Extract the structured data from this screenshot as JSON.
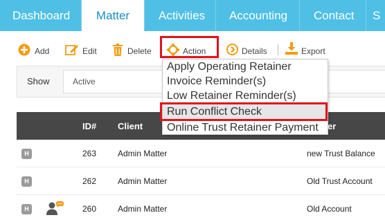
{
  "nav": {
    "tabs": [
      {
        "label": "Dashboard",
        "active": false
      },
      {
        "label": "Matter",
        "active": true
      },
      {
        "label": "Activities",
        "active": false
      },
      {
        "label": "Accounting",
        "active": false
      },
      {
        "label": "Contact",
        "active": false
      },
      {
        "label": "S",
        "active": false
      }
    ]
  },
  "toolbar": {
    "add_label": "Add",
    "edit_label": "Edit",
    "delete_label": "Delete",
    "action_label": "Action",
    "details_label": "Details",
    "export_label": "Export"
  },
  "filter": {
    "show_label": "Show",
    "status_value": "Active"
  },
  "table": {
    "headers": {
      "id": "ID#",
      "client": "Client",
      "matter_partial": "er"
    },
    "rows": [
      {
        "badge": "H",
        "id": "263",
        "client": "Admin Matter",
        "matter": "new Trust Balance",
        "has_contact_icon": false
      },
      {
        "badge": "H",
        "id": "262",
        "client": "Admin Matter",
        "matter": "Old Trust Account",
        "has_contact_icon": false
      },
      {
        "badge": "H",
        "id": "260",
        "client": "Admin Matter",
        "matter": "Old Account",
        "has_contact_icon": true
      }
    ]
  },
  "action_menu": {
    "items": [
      {
        "label": "Apply Operating Retainer"
      },
      {
        "label": "Invoice Reminder(s)"
      },
      {
        "label": "Low Retainer Reminder(s)"
      },
      {
        "label": "Run Conflict Check",
        "highlighted": true
      },
      {
        "label": "Online Trust Retainer Payment"
      }
    ]
  },
  "colors": {
    "nav_bg": "#4fbfe5",
    "active_tab_text": "#1a8fc2",
    "icon_orange": "#f39c12",
    "highlight_border": "#e2121a",
    "table_header_bg": "#474747"
  }
}
